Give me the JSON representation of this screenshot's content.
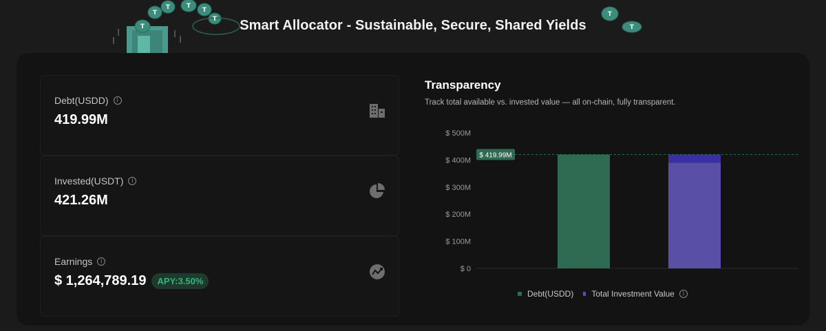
{
  "banner": {
    "title": "Smart Allocator - Sustainable, Secure, Shared Yields"
  },
  "stats": [
    {
      "label": "Debt(USDD)",
      "value": "419.99M",
      "icon": "building-icon"
    },
    {
      "label": "Invested(USDT)",
      "value": "421.26M",
      "icon": "pie-chart-icon"
    },
    {
      "label": "Earnings",
      "value": "$ 1,264,789.19",
      "badge": "APY:3.50%",
      "icon": "trend-chart-icon"
    }
  ],
  "transparency": {
    "title": "Transparency",
    "subtitle": "Track total available vs. invested value — all on-chain, fully transparent."
  },
  "chart_data": {
    "type": "bar",
    "categories": [
      "Debt(USDD)",
      "Total Investment Value"
    ],
    "series": [
      {
        "name": "Debt(USDD)",
        "values": [
          419.99,
          0
        ],
        "color": "#2f6a52"
      },
      {
        "name": "Total Investment Value",
        "values": [
          0,
          419.99
        ],
        "color": "#5a4fa6",
        "top_color": "#3a30a6"
      }
    ],
    "yticks": [
      "$ 0",
      "$ 100M",
      "$ 200M",
      "$ 300M",
      "$ 400M",
      "$ 500M"
    ],
    "ylim": [
      0,
      500
    ],
    "reference_line": {
      "value": 419.99,
      "label": "$ 419.99M"
    },
    "invested_base": 390,
    "legend": {
      "items": [
        "Debt(USDD)",
        "Total Investment Value"
      ],
      "position": "bottom"
    }
  },
  "colors": {
    "background": "#1a1b1a",
    "card": "#121312",
    "accent_green": "#35b27d",
    "debt_bar": "#2f6a52",
    "invested_bar": "#5a4fa6"
  }
}
